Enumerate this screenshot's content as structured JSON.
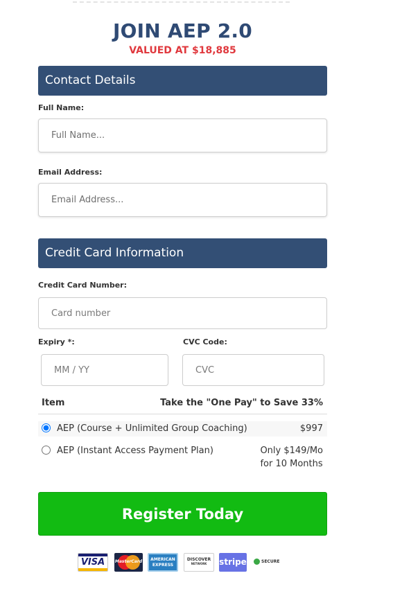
{
  "header": {
    "title": "JOIN AEP 2.0",
    "subtitle": "VALUED AT $18,885"
  },
  "contact": {
    "section_title": "Contact Details",
    "full_name_label": "Full Name:",
    "full_name_placeholder": "Full Name...",
    "email_label": "Email Address:",
    "email_placeholder": "Email Address..."
  },
  "card": {
    "section_title": "Credit Card Information",
    "number_label": "Credit Card Number:",
    "number_placeholder": "Card number",
    "expiry_label": "Expiry *:",
    "expiry_placeholder": "MM / YY",
    "cvc_label": "CVC Code:",
    "cvc_placeholder": "CVC"
  },
  "order": {
    "item_header": "Item",
    "price_header": "Take the \"One Pay\" to Save 33%",
    "options": [
      {
        "label": "AEP (Course + Unlimited Group Coaching)",
        "price": "$997",
        "selected": true
      },
      {
        "label": "AEP (Instant Access Payment Plan)",
        "price_line1": "Only $149/Mo",
        "price_line2": "for 10 Months",
        "selected": false
      }
    ]
  },
  "submit": {
    "label": "Register Today",
    "color": "#12bb12"
  },
  "payment_badges": {
    "visa": "VISA",
    "mastercard": "MasterCard",
    "amex_line1": "AMERICAN",
    "amex_line2": "EXPRESS",
    "discover": "DISCOVER",
    "discover_sub": "NETWORK",
    "stripe": "stripe",
    "secure": "SECURE"
  },
  "colors": {
    "brand_navy": "#334f75",
    "headline": "#2f4a74",
    "accent_red": "#e0393e",
    "button_green": "#12bb12"
  }
}
